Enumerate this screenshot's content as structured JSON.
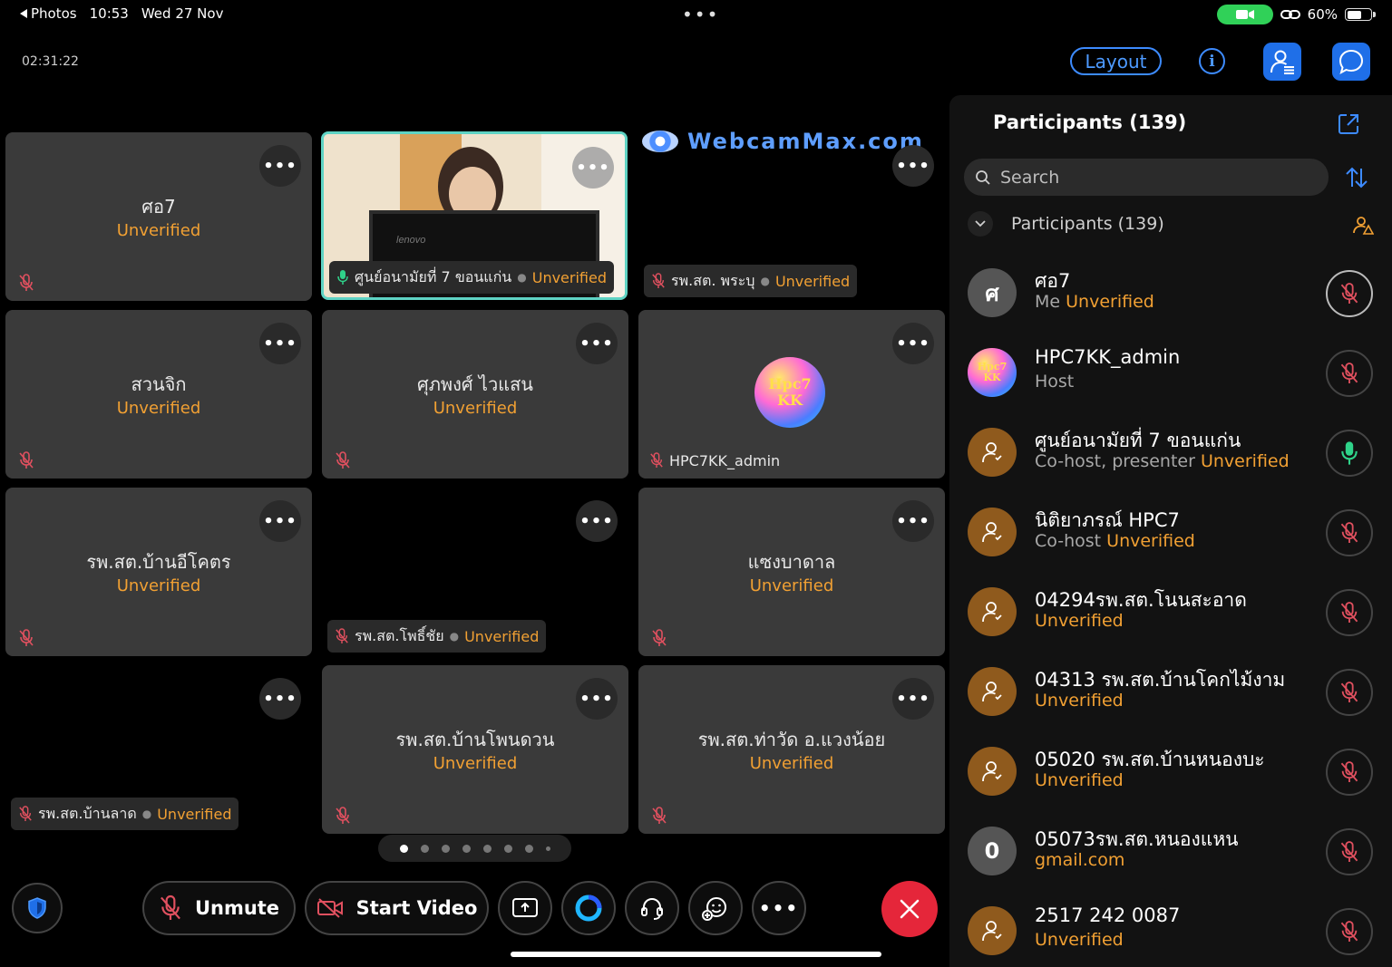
{
  "status_bar": {
    "back_label": "Photos",
    "time": "10:53",
    "date": "Wed 27 Nov",
    "battery": "60%",
    "battery_level": 0.6
  },
  "meeting": {
    "elapsed": "02:31:22",
    "layout_label": "Layout"
  },
  "tiles": [
    {
      "name": "ศอ7",
      "status": "Unverified"
    },
    {
      "name": "ศูนย์อนามัยที่ 7 ขอนแก่น",
      "status": "Unverified"
    },
    {
      "name": "รพ.สต. พระบุ",
      "status": "Unverified",
      "overlay": "WebcamMax.com"
    },
    {
      "name": "สวนจิก",
      "status": "Unverified"
    },
    {
      "name": "ศุภพงศ์ ไวแสน",
      "status": "Unverified"
    },
    {
      "name": "HPC7KK_admin",
      "avatar_text": "Hpc7 KK"
    },
    {
      "name": "รพ.สต.บ้านอีโคตร",
      "status": "Unverified"
    },
    {
      "name": "รพ.สต.โพธิ์ชัย",
      "status": "Unverified"
    },
    {
      "name": "แซงบาดาล",
      "status": "Unverified"
    },
    {
      "name": "รพ.สต.บ้านลาด",
      "status": "Unverified"
    },
    {
      "name": "รพ.สต.บ้านโพนดวน",
      "status": "Unverified"
    },
    {
      "name": "รพ.สต.ท่าวัด อ.แวงน้อย",
      "status": "Unverified"
    }
  ],
  "toolbar": {
    "unmute_label": "Unmute",
    "start_video_label": "Start Video"
  },
  "panel": {
    "title": "Participants (139)",
    "search_placeholder": "Search",
    "section_label": "Participants (139)",
    "participants": [
      {
        "initial": "ศ",
        "name": "ศอ7",
        "role": "Me",
        "status": "Unverified",
        "mic": "muted"
      },
      {
        "initial": "Hpc7 KK",
        "name": "HPC7KK_admin",
        "role": "Host",
        "status": "",
        "mic": "muted"
      },
      {
        "initial": "",
        "name": "ศูนย์อนามัยที่ 7 ขอนแก่น",
        "role": "Co-host, presenter",
        "status": "Unverified",
        "mic": "active"
      },
      {
        "initial": "",
        "name": "นิติยาภรณ์ HPC7",
        "role": "Co-host",
        "status": "Unverified",
        "mic": "muted"
      },
      {
        "initial": "",
        "name": "04294รพ.สต.โนนสะอาด",
        "role": "",
        "status": "Unverified",
        "mic": "muted"
      },
      {
        "initial": "",
        "name": "04313 รพ.สต.บ้านโคกไม้งาม",
        "role": "",
        "status": "Unverified",
        "mic": "muted"
      },
      {
        "initial": "",
        "name": "05020 รพ.สต.บ้านหนองบะ",
        "role": "",
        "status": "Unverified",
        "mic": "muted"
      },
      {
        "initial": "0",
        "name": "05073รพ.สต.หนองแหน",
        "role": "",
        "status": "gmail.com",
        "mic": "muted"
      },
      {
        "initial": "",
        "name": "2517 242 0087",
        "role": "",
        "status": "Unverified",
        "mic": "muted"
      }
    ]
  },
  "colors": {
    "accent_blue": "#3d8bff",
    "unverified_orange": "#f1a033",
    "end_red": "#e5263a",
    "mic_muted": "#e0505f",
    "mic_active": "#2fd38a"
  },
  "icons": [
    "back-icon",
    "camera-pill-icon",
    "link-icon",
    "battery-icon",
    "info-icon",
    "participants-icon",
    "chat-icon",
    "more-icon",
    "mic-off-icon",
    "video-off-icon",
    "share-icon",
    "ai-assistant-icon",
    "headset-icon",
    "reactions-icon",
    "shield-icon",
    "end-call-icon",
    "popout-icon",
    "search-icon",
    "sort-icon",
    "chevron-down-icon",
    "person-icon",
    "mic-on-icon"
  ]
}
